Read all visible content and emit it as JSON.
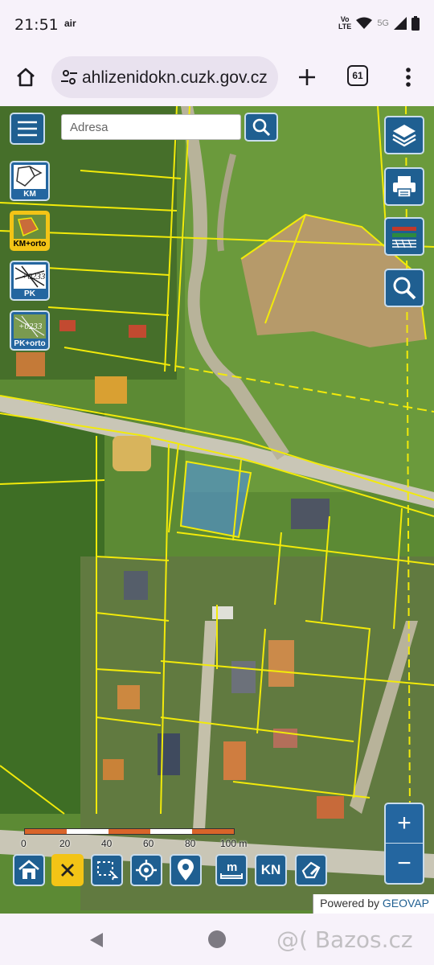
{
  "status_bar": {
    "time": "21:51",
    "app_indicator": "air",
    "volte_line1": "Vo",
    "volte_line2": "LTE",
    "network": "5G"
  },
  "browser": {
    "url": "ahlizenidokn.cuzk.gov.cz",
    "tab_count": "61"
  },
  "map": {
    "search": {
      "placeholder": "Adresa"
    },
    "layers": [
      {
        "label": "KM"
      },
      {
        "label": "KM+orto"
      },
      {
        "label": "PK"
      },
      {
        "label": "PK+orto"
      }
    ],
    "scale": {
      "labels": [
        "0",
        "20",
        "40",
        "60",
        "80",
        "100 m"
      ]
    },
    "tools": {
      "kn_label": "KN",
      "measure_label": "m"
    },
    "zoom": {
      "in": "+",
      "out": "−"
    },
    "powered_by": {
      "prefix": "Powered by",
      "brand": "GEOVAP"
    }
  },
  "watermark": "@( Bazos.cz",
  "colors": {
    "accent": "#1f5f91",
    "parcel": "#f2ea0a",
    "highlight": "#f3c416"
  }
}
